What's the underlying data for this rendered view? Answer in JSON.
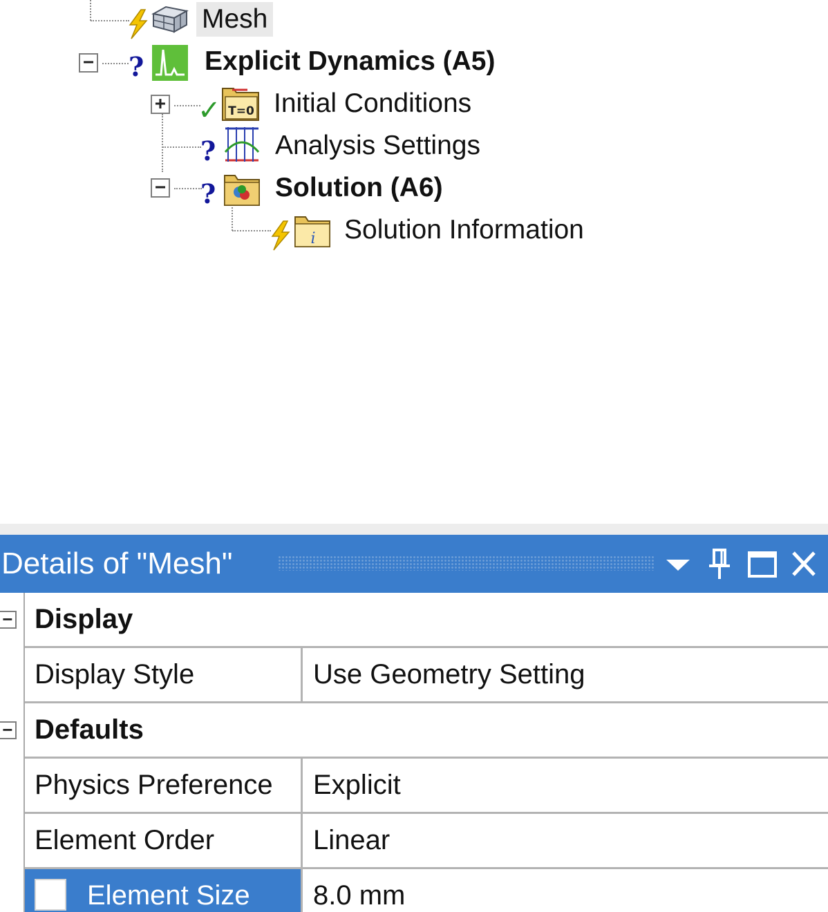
{
  "tree": {
    "items": [
      {
        "label": "Mesh",
        "bold": false,
        "selected": true,
        "status": "lightning",
        "icon": "mesh-icon"
      },
      {
        "label": "Explicit Dynamics (A5)",
        "bold": true,
        "status": "question",
        "icon": "explicit-dynamics-icon",
        "toggle": "−"
      },
      {
        "label": "Initial Conditions",
        "bold": false,
        "status": "check",
        "icon": "initial-conditions-icon",
        "toggle": "+"
      },
      {
        "label": "Analysis Settings",
        "bold": false,
        "status": "question",
        "icon": "analysis-settings-icon"
      },
      {
        "label": "Solution (A6)",
        "bold": true,
        "status": "question",
        "icon": "solution-icon",
        "toggle": "−"
      },
      {
        "label": "Solution Information",
        "bold": false,
        "status": "lightning",
        "icon": "solution-information-icon"
      }
    ],
    "status_glyphs": {
      "question": "?",
      "check": "✓",
      "lightning": "⚡"
    },
    "icon_text": {
      "t0": "T=0",
      "info": "i"
    }
  },
  "details": {
    "title": "Details of \"Mesh\"",
    "header_buttons": [
      "dropdown-icon",
      "pin-icon",
      "maximize-icon",
      "close-icon"
    ],
    "categories": [
      {
        "label": "Display",
        "toggle": "−",
        "rows": [
          {
            "property": "Display Style",
            "value": "Use Geometry Setting"
          }
        ]
      },
      {
        "label": "Defaults",
        "toggle": "−",
        "rows": [
          {
            "property": "Physics Preference",
            "value": "Explicit"
          },
          {
            "property": "Element Order",
            "value": "Linear"
          },
          {
            "property": "Element Size",
            "value": "8.0 mm",
            "selected": true,
            "checkbox": false
          }
        ]
      }
    ]
  },
  "colors": {
    "header_blue": "#3a7dcc",
    "selection_blue": "#3a7dcc",
    "question_mark": "#12179a",
    "check_green": "#2c9a2a",
    "lightning_yellow": "#f4c400",
    "explicit_icon_green": "#5fbf3a"
  }
}
